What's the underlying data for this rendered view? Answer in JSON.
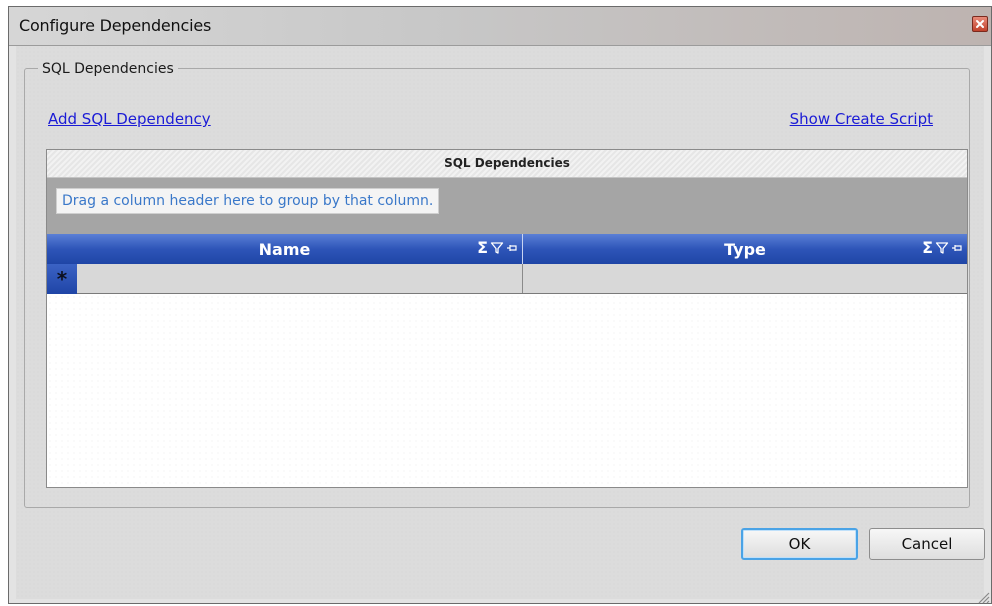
{
  "window": {
    "title": "Configure Dependencies"
  },
  "groupbox": {
    "label": "SQL Dependencies"
  },
  "links": {
    "add_dependency": "Add SQL Dependency",
    "show_create_script": "Show Create Script"
  },
  "grid": {
    "caption": "SQL Dependencies",
    "group_hint": "Drag a column header here to group by that column.",
    "columns": [
      {
        "label": "Name"
      },
      {
        "label": "Type"
      }
    ],
    "new_row_indicator": "*",
    "column_icons": [
      "sum-icon",
      "filter-icon",
      "pin-icon"
    ]
  },
  "buttons": {
    "ok": "OK",
    "cancel": "Cancel"
  },
  "colors": {
    "header_blue": "#2e55b8",
    "link_blue": "#1b1bd6",
    "hint_text": "#3a78c9",
    "ok_focus": "#4aa3e6"
  }
}
